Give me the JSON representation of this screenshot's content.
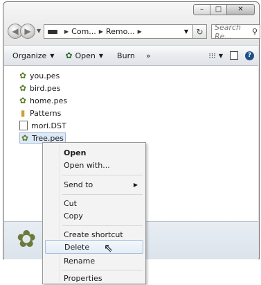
{
  "window": {
    "caption_buttons": {
      "minimize": "–",
      "maximize": "□",
      "close": "✕"
    }
  },
  "address_bar": {
    "crumbs": [
      "Com...",
      "Remo..."
    ],
    "search_placeholder": "Search Re..."
  },
  "toolbar": {
    "organize_label": "Organize",
    "open_label": "Open",
    "burn_label": "Burn",
    "more_label": "»"
  },
  "files": [
    {
      "name": "you.pes",
      "type": "pes"
    },
    {
      "name": "bird.pes",
      "type": "pes"
    },
    {
      "name": "home.pes",
      "type": "pes"
    },
    {
      "name": "Patterns",
      "type": "folder"
    },
    {
      "name": "mori.DST",
      "type": "doc"
    },
    {
      "name": "Tree.pes",
      "type": "pes",
      "selected": true
    }
  ],
  "context_menu": {
    "items": [
      {
        "label": "Open",
        "bold": true
      },
      {
        "label": "Open with..."
      },
      {
        "label": "Send to",
        "submenu": true
      },
      {
        "label": "Cut"
      },
      {
        "label": "Copy"
      },
      {
        "label": "Create shortcut"
      },
      {
        "label": "Delete",
        "hovered": true
      },
      {
        "label": "Rename"
      },
      {
        "label": "Properties"
      }
    ]
  },
  "icons": {
    "pes_file": "flower-icon",
    "folder": "folder-icon",
    "generic_file": "document-icon"
  }
}
